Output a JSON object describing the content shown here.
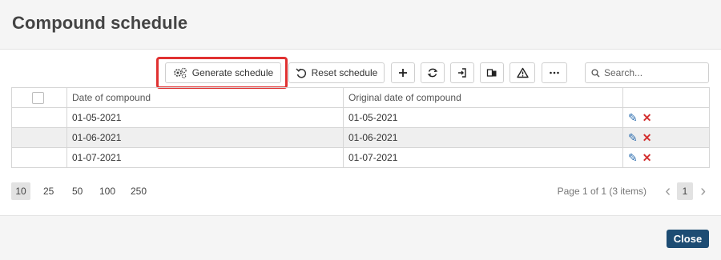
{
  "dialog": {
    "title": "Compound schedule"
  },
  "toolbar": {
    "generate_label": "Generate schedule",
    "reset_label": "Reset schedule",
    "icons": [
      "plus-icon",
      "refresh-icon",
      "export-icon",
      "copy-icon",
      "warning-icon",
      "more-icon"
    ]
  },
  "search": {
    "placeholder": "Search..."
  },
  "grid": {
    "columns": [
      "Date of compound",
      "Original date of compound"
    ],
    "rows": [
      {
        "date": "01-05-2021",
        "original": "01-05-2021"
      },
      {
        "date": "01-06-2021",
        "original": "01-06-2021"
      },
      {
        "date": "01-07-2021",
        "original": "01-07-2021"
      }
    ]
  },
  "pager": {
    "sizes": [
      "10",
      "25",
      "50",
      "100",
      "250"
    ],
    "selected_size": "10",
    "info": "Page 1 of 1 (3 items)",
    "current_page": "1"
  },
  "footer": {
    "close_label": "Close"
  },
  "colors": {
    "accent": "#1d4c73",
    "highlight": "#e03131",
    "delete": "#d32f2f",
    "edit": "#2f6fb0"
  }
}
